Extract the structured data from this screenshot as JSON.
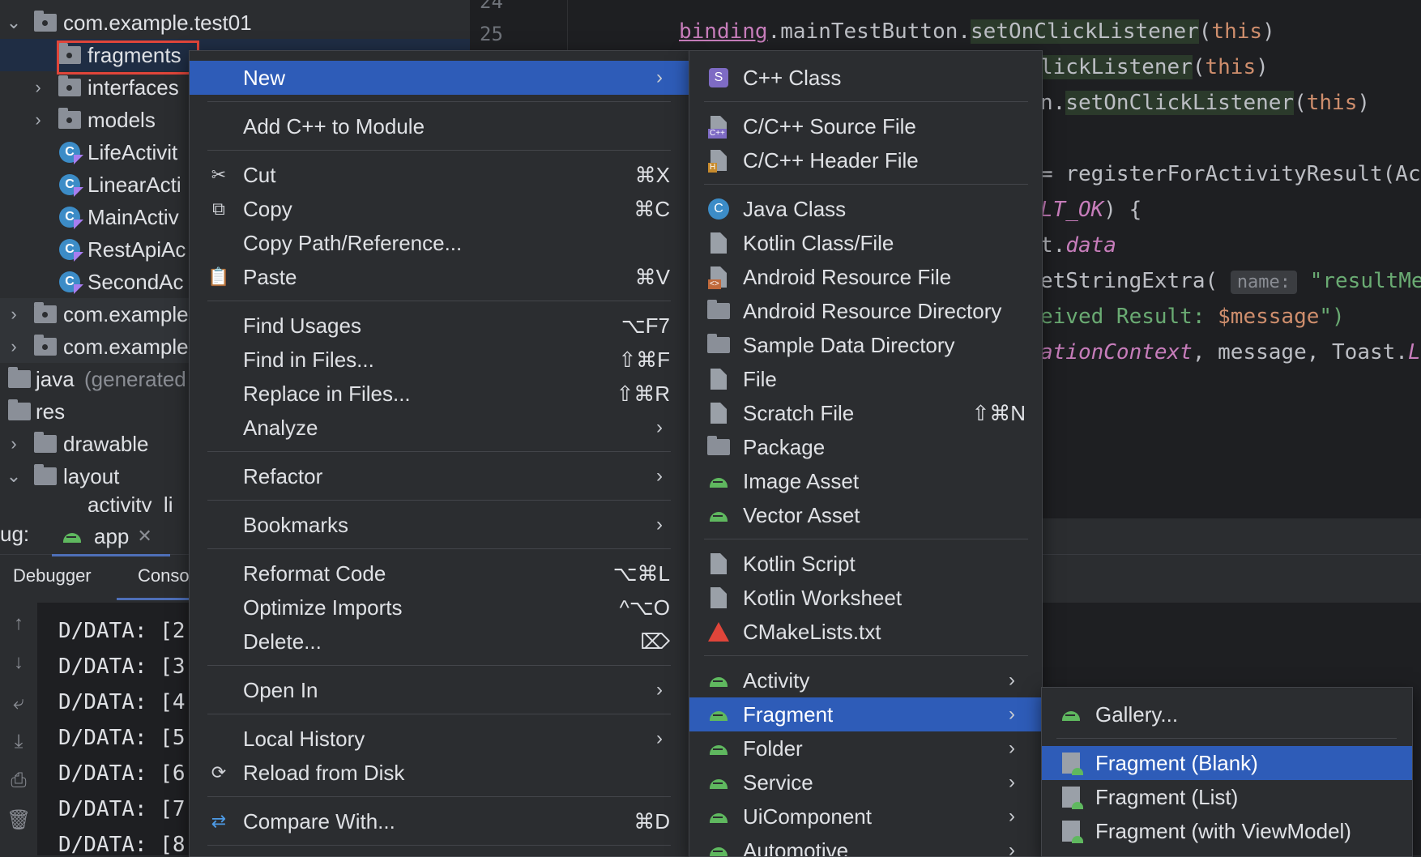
{
  "tree": {
    "items": [
      {
        "label": "com.example.test01",
        "expanded": true
      },
      {
        "label": "fragments"
      },
      {
        "label": "interfaces"
      },
      {
        "label": "models"
      },
      {
        "label": "LifeActivit"
      },
      {
        "label": "LinearActi"
      },
      {
        "label": "MainActiv"
      },
      {
        "label": "RestApiAc"
      },
      {
        "label": "SecondAc"
      },
      {
        "label": "com.example"
      },
      {
        "label": "com.example"
      },
      {
        "label": "java",
        "suffix": "(generated"
      },
      {
        "label": "res"
      },
      {
        "label": "drawable"
      },
      {
        "label": "layout"
      },
      {
        "label": "activity_li"
      }
    ]
  },
  "editor": {
    "line_numbers": [
      "24",
      "25"
    ],
    "lines": {
      "l1_obj": "binding",
      "l1_rest": ".mainTestButton.",
      "l1_fn": "setOnClickListener",
      "l1_open": "(",
      "l1_kw": "this",
      "l1_close": ")",
      "l2_fn": "lickListener",
      "l2_kw": "this",
      "l3_pre": "n.",
      "l3_fn": "setOnClickListener",
      "l3_kw": "this",
      "l4": "= registerForActivityResult(Ac",
      "l5_it": "LT_OK",
      "l5_rest": ") {",
      "l6_pre": "t.",
      "l6_it": "data",
      "l7_pre": "etStringExtra(",
      "l7_hint": "name:",
      "l7_str": "\"resultMes",
      "l8_str": "eived Result: ",
      "l8_var": "$message",
      "l8_end": "\")",
      "l9_it": "ationContext",
      "l9_rest": ", message, Toast.",
      "l9_end": "L"
    }
  },
  "debug": {
    "label": "ug:",
    "app_tab": "app",
    "tabs": [
      "Debugger",
      "Conso"
    ],
    "logs": [
      "D/DATA: [2",
      "D/DATA: [3",
      "D/DATA: [4",
      "D/DATA: [5",
      "D/DATA: [6",
      "D/DATA: [7",
      "D/DATA: [8"
    ]
  },
  "menu1": {
    "items": [
      {
        "label": "New",
        "arrow": "›",
        "active": true
      },
      {
        "label": "Add C++ to Module"
      },
      {
        "label": "Cut",
        "shortcut": "⌘X",
        "icon": "scissors-icon"
      },
      {
        "label": "Copy",
        "shortcut": "⌘C",
        "icon": "copy-icon"
      },
      {
        "label": "Copy Path/Reference..."
      },
      {
        "label": "Paste",
        "shortcut": "⌘V",
        "icon": "paste-icon"
      },
      {
        "label": "Find Usages",
        "shortcut": "⌥F7"
      },
      {
        "label": "Find in Files...",
        "shortcut": "⇧⌘F"
      },
      {
        "label": "Replace in Files...",
        "shortcut": "⇧⌘R"
      },
      {
        "label": "Analyze",
        "arrow": "›"
      },
      {
        "label": "Refactor",
        "arrow": "›"
      },
      {
        "label": "Bookmarks",
        "arrow": "›"
      },
      {
        "label": "Reformat Code",
        "shortcut": "⌥⌘L"
      },
      {
        "label": "Optimize Imports",
        "shortcut": "^⌥O"
      },
      {
        "label": "Delete...",
        "shortcut": "⌦"
      },
      {
        "label": "Open In",
        "arrow": "›"
      },
      {
        "label": "Local History",
        "arrow": "›"
      },
      {
        "label": "Reload from Disk",
        "icon": "reload-icon"
      },
      {
        "label": "Compare With...",
        "shortcut": "⌘D",
        "icon": "compare-icon"
      }
    ]
  },
  "menu2": {
    "items": [
      {
        "label": "C++ Class",
        "icon": "s-class-icon",
        "icon_text": "S"
      },
      {
        "label": "C/C++ Source File",
        "icon": "cpp-source-icon",
        "icon_text": "C++"
      },
      {
        "label": "C/C++ Header File",
        "icon": "cpp-header-icon",
        "icon_text": "H"
      },
      {
        "label": "Java Class",
        "icon": "java-class-icon",
        "icon_text": "C"
      },
      {
        "label": "Kotlin Class/File",
        "icon": "kotlin-file-icon"
      },
      {
        "label": "Android Resource File",
        "icon": "resource-file-icon",
        "icon_text": "<>"
      },
      {
        "label": "Android Resource Directory",
        "icon": "folder-icon"
      },
      {
        "label": "Sample Data Directory",
        "icon": "folder-icon"
      },
      {
        "label": "File",
        "icon": "file-icon"
      },
      {
        "label": "Scratch File",
        "shortcut": "⇧⌘N",
        "icon": "scratch-file-icon"
      },
      {
        "label": "Package",
        "icon": "package-icon"
      },
      {
        "label": "Image Asset",
        "icon": "android-icon"
      },
      {
        "label": "Vector Asset",
        "icon": "android-icon"
      },
      {
        "label": "Kotlin Script",
        "icon": "kotlin-script-icon"
      },
      {
        "label": "Kotlin Worksheet",
        "icon": "kotlin-worksheet-icon"
      },
      {
        "label": "CMakeLists.txt",
        "icon": "cmake-icon"
      },
      {
        "label": "Activity",
        "arrow": "›",
        "icon": "android-icon"
      },
      {
        "label": "Fragment",
        "arrow": "›",
        "icon": "android-icon",
        "active": true
      },
      {
        "label": "Folder",
        "arrow": "›",
        "icon": "android-icon"
      },
      {
        "label": "Service",
        "arrow": "›",
        "icon": "android-icon"
      },
      {
        "label": "UiComponent",
        "arrow": "›",
        "icon": "android-icon"
      },
      {
        "label": "Automotive",
        "arrow": "›",
        "icon": "android-icon"
      }
    ]
  },
  "menu3": {
    "items": [
      {
        "label": "Gallery...",
        "icon": "android-icon"
      },
      {
        "label": "Fragment (Blank)",
        "icon": "fragment-icon",
        "active": true
      },
      {
        "label": "Fragment (List)",
        "icon": "fragment-icon"
      },
      {
        "label": "Fragment (with ViewModel)",
        "icon": "fragment-icon"
      }
    ]
  },
  "colors": {
    "accent": "#2e5cb8",
    "highlight_border": "#e0453a",
    "android_green": "#5fb85f",
    "background": "#2b2d30",
    "editor_bg": "#1e1f22"
  }
}
